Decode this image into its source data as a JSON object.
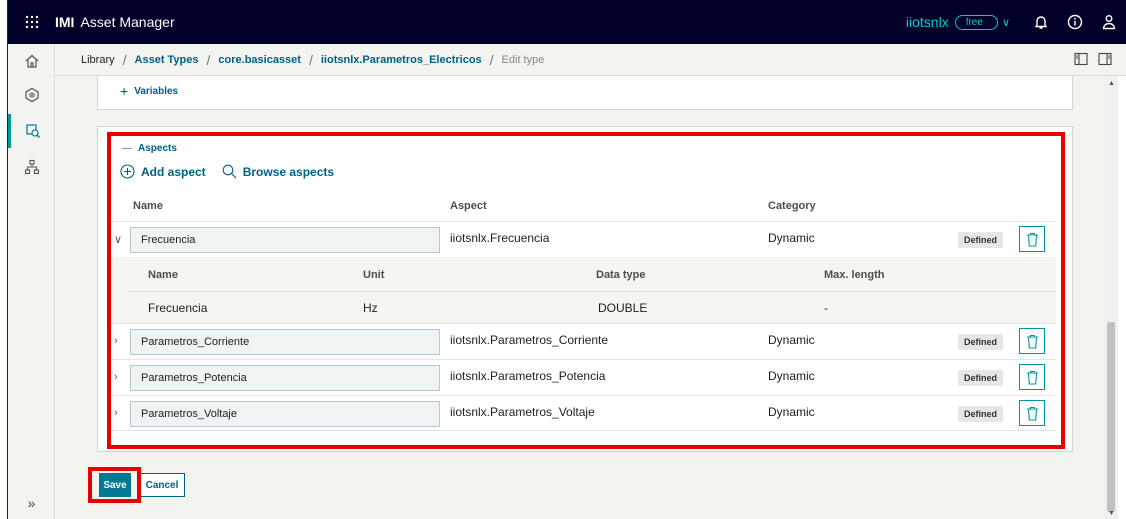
{
  "header": {
    "app_brand": "IMI",
    "app_name": "Asset Manager",
    "tenant": "iiotsnlx",
    "plan": "free",
    "icons": [
      "apps-grid-icon",
      "bell-icon",
      "info-icon",
      "user-icon",
      "chevron-down-icon"
    ]
  },
  "sidebar": {
    "items": [
      "home-icon",
      "cube-icon",
      "asset-type-icon",
      "hierarchy-icon"
    ],
    "active_index": 2,
    "collapse_label": "»"
  },
  "breadcrumb": {
    "items": [
      "Library",
      "Asset Types",
      "core.basicasset",
      "iiotsnlx.Parametros_Electricos",
      "Edit type"
    ]
  },
  "variables": {
    "label": "Variables",
    "toggle": "+"
  },
  "aspects": {
    "label": "Aspects",
    "toggle": "—",
    "add_label": "Add aspect",
    "browse_label": "Browse aspects",
    "columns": [
      "Name",
      "Aspect",
      "Category"
    ],
    "rows": [
      {
        "name": "Frecuencia",
        "aspect": "iiotsnlx.Frecuencia",
        "category": "Dynamic",
        "badge": "Defined",
        "expanded": true
      },
      {
        "name": "Parametros_Corriente",
        "aspect": "iiotsnlx.Parametros_Corriente",
        "category": "Dynamic",
        "badge": "Defined",
        "expanded": false
      },
      {
        "name": "Parametros_Potencia",
        "aspect": "iiotsnlx.Parametros_Potencia",
        "category": "Dynamic",
        "badge": "Defined",
        "expanded": false
      },
      {
        "name": "Parametros_Voltaje",
        "aspect": "iiotsnlx.Parametros_Voltaje",
        "category": "Dynamic",
        "badge": "Defined",
        "expanded": false
      }
    ],
    "variables_table": {
      "columns": [
        "Name",
        "Unit",
        "Data type",
        "Max. length"
      ],
      "rows": [
        {
          "name": "Frecuencia",
          "unit": "Hz",
          "data_type": "DOUBLE",
          "max_length": "-"
        }
      ]
    }
  },
  "footer": {
    "save_label": "Save",
    "cancel_label": "Cancel"
  },
  "colors": {
    "topbar": "#000028",
    "accent": "#009999",
    "link": "#005f87",
    "highlight": "#e60000",
    "primary_button": "#007993"
  }
}
